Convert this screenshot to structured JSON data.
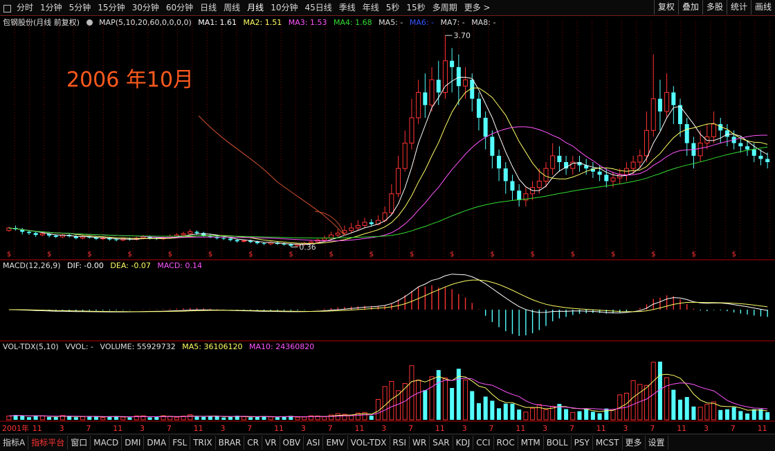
{
  "toolbar": {
    "periods": [
      "分时",
      "1分钟",
      "5分钟",
      "15分钟",
      "30分钟",
      "60分钟",
      "日线",
      "周线",
      "月线",
      "10分钟",
      "45日线",
      "季线",
      "年线",
      "5秒",
      "15秒",
      "多周期",
      "更多 >"
    ],
    "active_period": "月线",
    "right_buttons": [
      "复权",
      "叠加",
      "多股",
      "统计",
      "画线"
    ]
  },
  "main_info": {
    "name": "包钢股份(月线 前复权)",
    "map_label": "MAP(5,10,20,60,0,0,0,0)",
    "ma1": "MA1: 1.61",
    "ma2": "MA2: 1.51",
    "ma3": "MA3: 1.53",
    "ma4": "MA4: 1.68",
    "ma5": "MA5: -",
    "ma6": "MA6: -",
    "ma7": "MA7: -",
    "ma8": "MA8: -"
  },
  "annotation": "2006 年10月",
  "price_labels": {
    "high": "3.70",
    "low": "0.36"
  },
  "macd_info": {
    "label": "MACD(12,26,9)",
    "dif": "DIF: -0.00",
    "dea": "DEA: -0.07",
    "macd": "MACD: 0.14"
  },
  "vol_info": {
    "label": "VOL-TDX(5,10)",
    "vvol": "VVOL: -",
    "volume": "VOLUME: 55929732",
    "ma5": "MA5: 36106120",
    "ma10": "MA10: 24360820"
  },
  "x_axis": {
    "start_label": "2001年",
    "month_pattern": [
      "11",
      "3",
      "7"
    ]
  },
  "bottom_tabs": [
    "指标A",
    "指标平台",
    "窗口",
    "MACD",
    "DMI",
    "DMA",
    "FSL",
    "TRIX",
    "BRAR",
    "CR",
    "VR",
    "OBV",
    "ASI",
    "EMV",
    "VOL-TDX",
    "RSI",
    "WR",
    "SAR",
    "KDJ",
    "CCI",
    "ROC",
    "MTM",
    "BOLL",
    "PSY",
    "MCST",
    "更多",
    "设置"
  ],
  "active_tab": "指标平台",
  "colors": {
    "up": "#ff3333",
    "down": "#54ffff",
    "ma1": "#ffffff",
    "ma2": "#ffff66",
    "ma3": "#ff55ff",
    "ma4": "#33dd33",
    "grid": "#8a0000",
    "annotation": "#ff5a1e"
  },
  "chart_data": {
    "type": "candlestick",
    "title": "包钢股份(月线 前复权)",
    "period": "monthly",
    "range_labels": [
      "2001年"
    ],
    "price_high": 3.7,
    "price_low": 0.36,
    "candles_approx": [
      [
        0.62,
        0.66,
        0.6,
        0.68
      ],
      [
        0.66,
        0.64,
        0.62,
        0.7
      ],
      [
        0.64,
        0.6,
        0.56,
        0.66
      ],
      [
        0.6,
        0.58,
        0.55,
        0.62
      ],
      [
        0.58,
        0.55,
        0.52,
        0.6
      ],
      [
        0.55,
        0.57,
        0.53,
        0.59
      ],
      [
        0.57,
        0.54,
        0.51,
        0.58
      ],
      [
        0.54,
        0.52,
        0.5,
        0.56
      ],
      [
        0.52,
        0.55,
        0.5,
        0.57
      ],
      [
        0.55,
        0.53,
        0.51,
        0.57
      ],
      [
        0.53,
        0.5,
        0.48,
        0.55
      ],
      [
        0.5,
        0.52,
        0.48,
        0.54
      ],
      [
        0.52,
        0.51,
        0.49,
        0.54
      ],
      [
        0.51,
        0.49,
        0.47,
        0.53
      ],
      [
        0.49,
        0.5,
        0.47,
        0.52
      ],
      [
        0.5,
        0.48,
        0.46,
        0.52
      ],
      [
        0.48,
        0.47,
        0.45,
        0.5
      ],
      [
        0.47,
        0.49,
        0.45,
        0.51
      ],
      [
        0.49,
        0.48,
        0.46,
        0.51
      ],
      [
        0.48,
        0.5,
        0.46,
        0.52
      ],
      [
        0.5,
        0.52,
        0.48,
        0.55
      ],
      [
        0.52,
        0.5,
        0.48,
        0.54
      ],
      [
        0.5,
        0.49,
        0.47,
        0.52
      ],
      [
        0.49,
        0.51,
        0.47,
        0.53
      ],
      [
        0.51,
        0.53,
        0.49,
        0.56
      ],
      [
        0.53,
        0.55,
        0.51,
        0.58
      ],
      [
        0.55,
        0.57,
        0.53,
        0.6
      ],
      [
        0.57,
        0.6,
        0.55,
        0.64
      ],
      [
        0.6,
        0.58,
        0.55,
        0.62
      ],
      [
        0.58,
        0.54,
        0.52,
        0.6
      ],
      [
        0.54,
        0.52,
        0.5,
        0.56
      ],
      [
        0.52,
        0.5,
        0.48,
        0.54
      ],
      [
        0.5,
        0.49,
        0.47,
        0.52
      ],
      [
        0.49,
        0.47,
        0.45,
        0.51
      ],
      [
        0.47,
        0.45,
        0.43,
        0.49
      ],
      [
        0.45,
        0.46,
        0.43,
        0.48
      ],
      [
        0.46,
        0.44,
        0.42,
        0.48
      ],
      [
        0.44,
        0.42,
        0.4,
        0.46
      ],
      [
        0.42,
        0.41,
        0.39,
        0.44
      ],
      [
        0.41,
        0.43,
        0.39,
        0.45
      ],
      [
        0.43,
        0.41,
        0.39,
        0.45
      ],
      [
        0.41,
        0.4,
        0.38,
        0.43
      ],
      [
        0.4,
        0.38,
        0.36,
        0.42
      ],
      [
        0.38,
        0.4,
        0.36,
        0.42
      ],
      [
        0.4,
        0.42,
        0.38,
        0.44
      ],
      [
        0.42,
        0.44,
        0.4,
        0.46
      ],
      [
        0.44,
        0.47,
        0.42,
        0.49
      ],
      [
        0.47,
        0.5,
        0.45,
        0.54
      ],
      [
        0.5,
        0.55,
        0.48,
        0.6
      ],
      [
        0.55,
        0.58,
        0.52,
        0.64
      ],
      [
        0.58,
        0.62,
        0.55,
        0.7
      ],
      [
        0.62,
        0.66,
        0.58,
        0.74
      ],
      [
        0.66,
        0.7,
        0.62,
        0.78
      ],
      [
        0.7,
        0.75,
        0.66,
        0.82
      ],
      [
        0.75,
        0.72,
        0.68,
        0.8
      ],
      [
        0.72,
        0.78,
        0.7,
        0.86
      ],
      [
        0.78,
        0.9,
        0.75,
        1.0
      ],
      [
        0.9,
        1.2,
        0.86,
        1.35
      ],
      [
        1.2,
        1.6,
        1.15,
        1.8
      ],
      [
        1.6,
        2.0,
        1.55,
        2.2
      ],
      [
        2.0,
        2.4,
        1.9,
        2.7
      ],
      [
        2.4,
        2.8,
        2.3,
        3.0
      ],
      [
        2.8,
        2.6,
        2.4,
        3.1
      ],
      [
        2.6,
        3.0,
        2.5,
        3.2
      ],
      [
        3.0,
        2.8,
        2.6,
        3.3
      ],
      [
        2.8,
        3.3,
        2.7,
        3.7
      ],
      [
        3.3,
        3.2,
        2.8,
        3.5
      ],
      [
        3.2,
        2.9,
        2.6,
        3.4
      ],
      [
        2.9,
        3.0,
        2.7,
        3.2
      ],
      [
        3.0,
        2.7,
        2.5,
        3.1
      ],
      [
        2.7,
        2.4,
        2.2,
        2.8
      ],
      [
        2.4,
        2.1,
        1.9,
        2.5
      ],
      [
        2.1,
        1.8,
        1.6,
        2.2
      ],
      [
        1.8,
        1.6,
        1.4,
        1.9
      ],
      [
        1.6,
        1.4,
        1.2,
        1.7
      ],
      [
        1.4,
        1.25,
        1.1,
        1.5
      ],
      [
        1.25,
        1.1,
        1.0,
        1.35
      ],
      [
        1.1,
        1.2,
        1.0,
        1.3
      ],
      [
        1.2,
        1.3,
        1.1,
        1.4
      ],
      [
        1.3,
        1.4,
        1.2,
        1.6
      ],
      [
        1.4,
        1.6,
        1.3,
        1.7
      ],
      [
        1.6,
        1.8,
        1.5,
        2.0
      ],
      [
        1.8,
        1.7,
        1.55,
        1.95
      ],
      [
        1.7,
        1.6,
        1.5,
        1.8
      ],
      [
        1.6,
        1.7,
        1.5,
        1.8
      ],
      [
        1.7,
        1.65,
        1.55,
        1.8
      ],
      [
        1.65,
        1.6,
        1.5,
        1.75
      ],
      [
        1.6,
        1.55,
        1.45,
        1.7
      ],
      [
        1.55,
        1.5,
        1.4,
        1.65
      ],
      [
        1.5,
        1.4,
        1.3,
        1.6
      ],
      [
        1.4,
        1.45,
        1.3,
        1.55
      ],
      [
        1.45,
        1.5,
        1.35,
        1.6
      ],
      [
        1.5,
        1.6,
        1.4,
        1.7
      ],
      [
        1.6,
        1.7,
        1.5,
        1.8
      ],
      [
        1.7,
        1.8,
        1.6,
        1.9
      ],
      [
        1.8,
        2.2,
        1.7,
        2.5
      ],
      [
        2.2,
        2.7,
        2.1,
        3.4
      ],
      [
        2.7,
        2.5,
        2.2,
        3.0
      ],
      [
        2.5,
        2.8,
        2.4,
        3.1
      ],
      [
        2.8,
        2.6,
        2.3,
        2.9
      ],
      [
        2.6,
        2.3,
        2.1,
        2.7
      ],
      [
        2.3,
        2.0,
        1.8,
        2.4
      ],
      [
        2.0,
        1.8,
        1.6,
        2.1
      ],
      [
        1.8,
        2.0,
        1.7,
        2.2
      ],
      [
        2.0,
        2.1,
        1.9,
        2.3
      ],
      [
        2.1,
        2.3,
        2.0,
        2.5
      ],
      [
        2.3,
        2.2,
        2.0,
        2.4
      ],
      [
        2.2,
        2.1,
        1.95,
        2.3
      ],
      [
        2.1,
        2.0,
        1.9,
        2.2
      ],
      [
        2.0,
        1.95,
        1.85,
        2.1
      ],
      [
        1.95,
        1.9,
        1.8,
        2.05
      ],
      [
        1.9,
        1.8,
        1.7,
        2.0
      ],
      [
        1.8,
        1.75,
        1.65,
        1.9
      ],
      [
        1.75,
        1.7,
        1.6,
        1.85
      ]
    ],
    "macd_axis_note": "MACD panel values approx",
    "volume_note": "Volume bars relative"
  }
}
